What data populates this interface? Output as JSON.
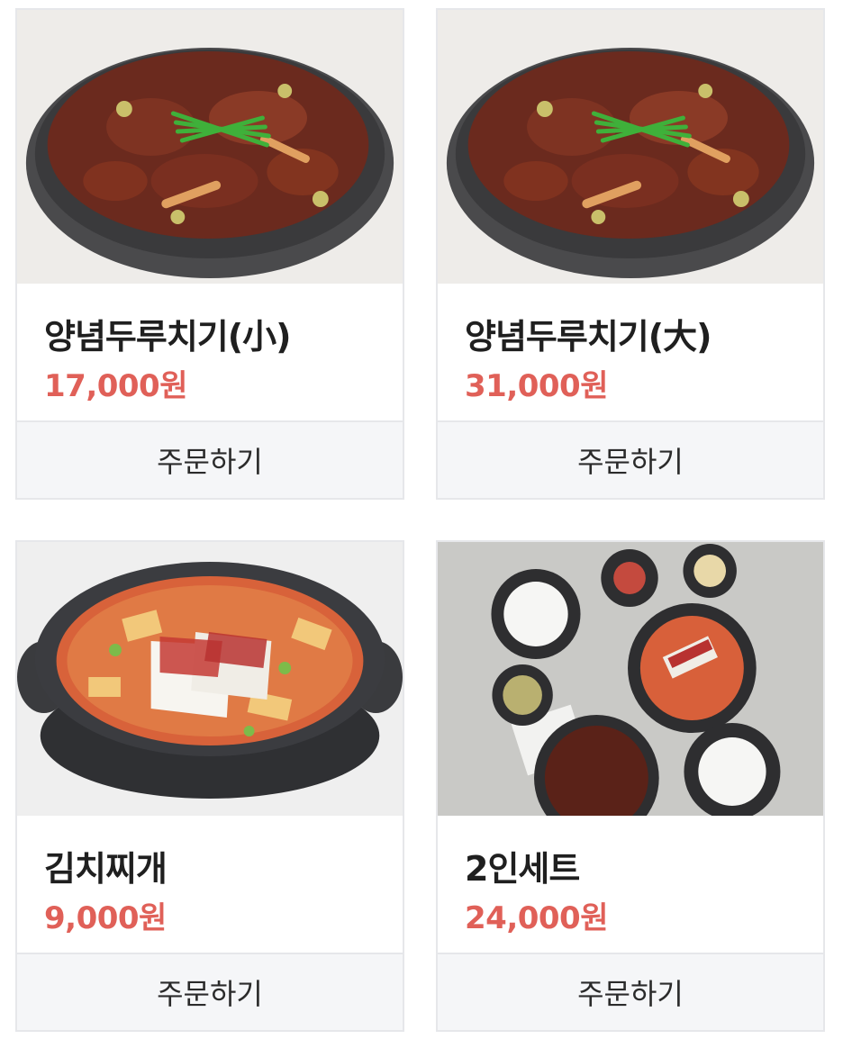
{
  "menu": {
    "items": [
      {
        "name": "양념두루치기(小)",
        "price": "17,000원",
        "order_label": "주문하기",
        "image": "spicy-pork-bowl"
      },
      {
        "name": "양념두루치기(大)",
        "price": "31,000원",
        "order_label": "주문하기",
        "image": "spicy-pork-bowl"
      },
      {
        "name": "김치찌개",
        "price": "9,000원",
        "order_label": "주문하기",
        "image": "kimchi-stew-pot"
      },
      {
        "name": "2인세트",
        "price": "24,000원",
        "order_label": "주문하기",
        "image": "set-meal-table"
      }
    ]
  },
  "colors": {
    "price": "#e06058",
    "border": "#e6e7ea",
    "button_bg": "#f5f6f8"
  }
}
